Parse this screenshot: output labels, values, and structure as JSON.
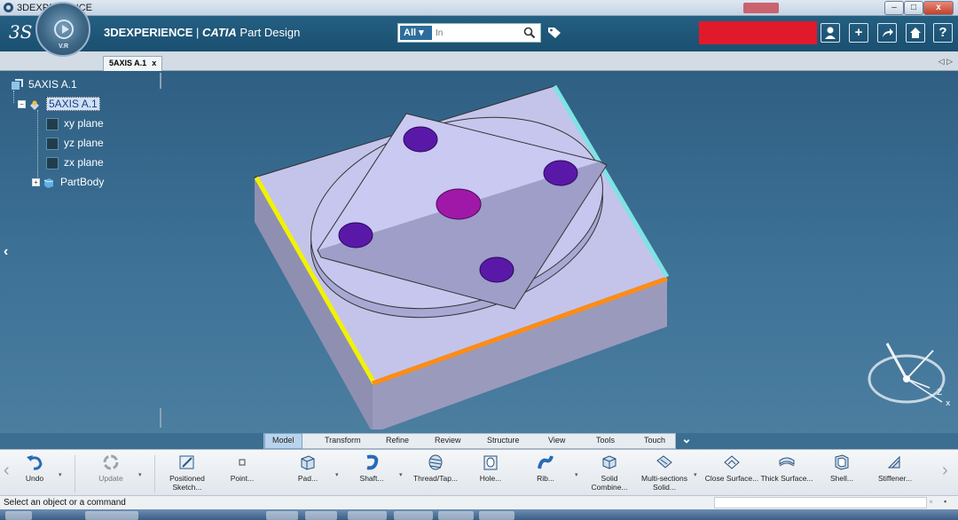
{
  "window": {
    "title": "3DEXPERIENCE",
    "controls": {
      "minimize": "–",
      "restore": "□",
      "close": "x"
    }
  },
  "header": {
    "ds_logo": "3S",
    "compass_label": "V.R",
    "brand_prefix": "3D",
    "brand_strong": "EXPERIENCE",
    "brand_separator": " | ",
    "brand_app": "CATIA",
    "brand_suffix": " Part Design",
    "search": {
      "scope": "All",
      "placeholder": "In"
    },
    "buttons": [
      "person",
      "plus",
      "share",
      "home",
      "help"
    ]
  },
  "tabs": [
    {
      "label": "5AXIS A.1",
      "close": "x"
    }
  ],
  "tabs_nav": "◁ ▷",
  "tree": {
    "root": "5AXIS A.1",
    "child": "5AXIS A.1",
    "planes": [
      "xy plane",
      "yz plane",
      "zx plane"
    ],
    "body": "PartBody"
  },
  "action_bar": {
    "tabs": [
      "Model",
      "Transform",
      "Refine",
      "Review",
      "Structure",
      "View",
      "Tools",
      "Touch"
    ],
    "active_tab": "Model",
    "tools": [
      {
        "label": "Undo",
        "icon": "undo-icon"
      },
      {
        "label": "Update",
        "icon": "update-icon"
      },
      {
        "label": "Positioned Sketch...",
        "icon": "positioned-sketch-icon"
      },
      {
        "label": "Point...",
        "icon": "point-icon"
      },
      {
        "label": "Pad...",
        "icon": "pad-icon"
      },
      {
        "label": "Shaft...",
        "icon": "shaft-icon"
      },
      {
        "label": "Thread/Tap...",
        "icon": "thread-tap-icon"
      },
      {
        "label": "Hole...",
        "icon": "hole-icon"
      },
      {
        "label": "Rib...",
        "icon": "rib-icon"
      },
      {
        "label": "Solid Combine...",
        "icon": "solid-combine-icon"
      },
      {
        "label": "Multi-sections Solid...",
        "icon": "multi-sections-solid-icon"
      },
      {
        "label": "Close Surface...",
        "icon": "close-surface-icon"
      },
      {
        "label": "Thick Surface...",
        "icon": "thick-surface-icon"
      },
      {
        "label": "Shell...",
        "icon": "shell-icon"
      },
      {
        "label": "Stiffener...",
        "icon": "stiffener-icon"
      }
    ]
  },
  "status": {
    "message": "Select an object or a command"
  },
  "colors": {
    "header": "#1f5a7e",
    "viewport": "#3b6e90",
    "part_top": "#c6c6ea",
    "part_side": "#8c8cae",
    "hole_small": "#5a18a8",
    "hole_center": "#a018a8",
    "edge_yellow": "#f2f200",
    "edge_orange": "#ff8c14",
    "edge_cyan": "#7fe3e3",
    "red_block": "#e01a2b"
  }
}
